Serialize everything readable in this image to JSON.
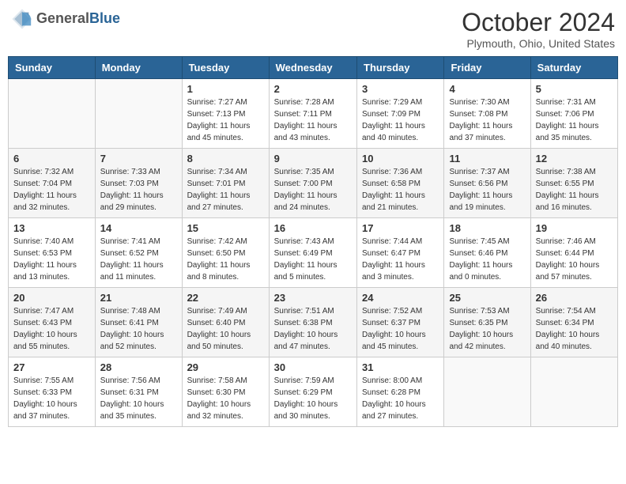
{
  "header": {
    "logo_line1": "General",
    "logo_line2": "Blue",
    "month_year": "October 2024",
    "location": "Plymouth, Ohio, United States"
  },
  "weekdays": [
    "Sunday",
    "Monday",
    "Tuesday",
    "Wednesday",
    "Thursday",
    "Friday",
    "Saturday"
  ],
  "weeks": [
    [
      {
        "day": "",
        "sunrise": "",
        "sunset": "",
        "daylight": ""
      },
      {
        "day": "",
        "sunrise": "",
        "sunset": "",
        "daylight": ""
      },
      {
        "day": "1",
        "sunrise": "Sunrise: 7:27 AM",
        "sunset": "Sunset: 7:13 PM",
        "daylight": "Daylight: 11 hours and 45 minutes."
      },
      {
        "day": "2",
        "sunrise": "Sunrise: 7:28 AM",
        "sunset": "Sunset: 7:11 PM",
        "daylight": "Daylight: 11 hours and 43 minutes."
      },
      {
        "day": "3",
        "sunrise": "Sunrise: 7:29 AM",
        "sunset": "Sunset: 7:09 PM",
        "daylight": "Daylight: 11 hours and 40 minutes."
      },
      {
        "day": "4",
        "sunrise": "Sunrise: 7:30 AM",
        "sunset": "Sunset: 7:08 PM",
        "daylight": "Daylight: 11 hours and 37 minutes."
      },
      {
        "day": "5",
        "sunrise": "Sunrise: 7:31 AM",
        "sunset": "Sunset: 7:06 PM",
        "daylight": "Daylight: 11 hours and 35 minutes."
      }
    ],
    [
      {
        "day": "6",
        "sunrise": "Sunrise: 7:32 AM",
        "sunset": "Sunset: 7:04 PM",
        "daylight": "Daylight: 11 hours and 32 minutes."
      },
      {
        "day": "7",
        "sunrise": "Sunrise: 7:33 AM",
        "sunset": "Sunset: 7:03 PM",
        "daylight": "Daylight: 11 hours and 29 minutes."
      },
      {
        "day": "8",
        "sunrise": "Sunrise: 7:34 AM",
        "sunset": "Sunset: 7:01 PM",
        "daylight": "Daylight: 11 hours and 27 minutes."
      },
      {
        "day": "9",
        "sunrise": "Sunrise: 7:35 AM",
        "sunset": "Sunset: 7:00 PM",
        "daylight": "Daylight: 11 hours and 24 minutes."
      },
      {
        "day": "10",
        "sunrise": "Sunrise: 7:36 AM",
        "sunset": "Sunset: 6:58 PM",
        "daylight": "Daylight: 11 hours and 21 minutes."
      },
      {
        "day": "11",
        "sunrise": "Sunrise: 7:37 AM",
        "sunset": "Sunset: 6:56 PM",
        "daylight": "Daylight: 11 hours and 19 minutes."
      },
      {
        "day": "12",
        "sunrise": "Sunrise: 7:38 AM",
        "sunset": "Sunset: 6:55 PM",
        "daylight": "Daylight: 11 hours and 16 minutes."
      }
    ],
    [
      {
        "day": "13",
        "sunrise": "Sunrise: 7:40 AM",
        "sunset": "Sunset: 6:53 PM",
        "daylight": "Daylight: 11 hours and 13 minutes."
      },
      {
        "day": "14",
        "sunrise": "Sunrise: 7:41 AM",
        "sunset": "Sunset: 6:52 PM",
        "daylight": "Daylight: 11 hours and 11 minutes."
      },
      {
        "day": "15",
        "sunrise": "Sunrise: 7:42 AM",
        "sunset": "Sunset: 6:50 PM",
        "daylight": "Daylight: 11 hours and 8 minutes."
      },
      {
        "day": "16",
        "sunrise": "Sunrise: 7:43 AM",
        "sunset": "Sunset: 6:49 PM",
        "daylight": "Daylight: 11 hours and 5 minutes."
      },
      {
        "day": "17",
        "sunrise": "Sunrise: 7:44 AM",
        "sunset": "Sunset: 6:47 PM",
        "daylight": "Daylight: 11 hours and 3 minutes."
      },
      {
        "day": "18",
        "sunrise": "Sunrise: 7:45 AM",
        "sunset": "Sunset: 6:46 PM",
        "daylight": "Daylight: 11 hours and 0 minutes."
      },
      {
        "day": "19",
        "sunrise": "Sunrise: 7:46 AM",
        "sunset": "Sunset: 6:44 PM",
        "daylight": "Daylight: 10 hours and 57 minutes."
      }
    ],
    [
      {
        "day": "20",
        "sunrise": "Sunrise: 7:47 AM",
        "sunset": "Sunset: 6:43 PM",
        "daylight": "Daylight: 10 hours and 55 minutes."
      },
      {
        "day": "21",
        "sunrise": "Sunrise: 7:48 AM",
        "sunset": "Sunset: 6:41 PM",
        "daylight": "Daylight: 10 hours and 52 minutes."
      },
      {
        "day": "22",
        "sunrise": "Sunrise: 7:49 AM",
        "sunset": "Sunset: 6:40 PM",
        "daylight": "Daylight: 10 hours and 50 minutes."
      },
      {
        "day": "23",
        "sunrise": "Sunrise: 7:51 AM",
        "sunset": "Sunset: 6:38 PM",
        "daylight": "Daylight: 10 hours and 47 minutes."
      },
      {
        "day": "24",
        "sunrise": "Sunrise: 7:52 AM",
        "sunset": "Sunset: 6:37 PM",
        "daylight": "Daylight: 10 hours and 45 minutes."
      },
      {
        "day": "25",
        "sunrise": "Sunrise: 7:53 AM",
        "sunset": "Sunset: 6:35 PM",
        "daylight": "Daylight: 10 hours and 42 minutes."
      },
      {
        "day": "26",
        "sunrise": "Sunrise: 7:54 AM",
        "sunset": "Sunset: 6:34 PM",
        "daylight": "Daylight: 10 hours and 40 minutes."
      }
    ],
    [
      {
        "day": "27",
        "sunrise": "Sunrise: 7:55 AM",
        "sunset": "Sunset: 6:33 PM",
        "daylight": "Daylight: 10 hours and 37 minutes."
      },
      {
        "day": "28",
        "sunrise": "Sunrise: 7:56 AM",
        "sunset": "Sunset: 6:31 PM",
        "daylight": "Daylight: 10 hours and 35 minutes."
      },
      {
        "day": "29",
        "sunrise": "Sunrise: 7:58 AM",
        "sunset": "Sunset: 6:30 PM",
        "daylight": "Daylight: 10 hours and 32 minutes."
      },
      {
        "day": "30",
        "sunrise": "Sunrise: 7:59 AM",
        "sunset": "Sunset: 6:29 PM",
        "daylight": "Daylight: 10 hours and 30 minutes."
      },
      {
        "day": "31",
        "sunrise": "Sunrise: 8:00 AM",
        "sunset": "Sunset: 6:28 PM",
        "daylight": "Daylight: 10 hours and 27 minutes."
      },
      {
        "day": "",
        "sunrise": "",
        "sunset": "",
        "daylight": ""
      },
      {
        "day": "",
        "sunrise": "",
        "sunset": "",
        "daylight": ""
      }
    ]
  ]
}
